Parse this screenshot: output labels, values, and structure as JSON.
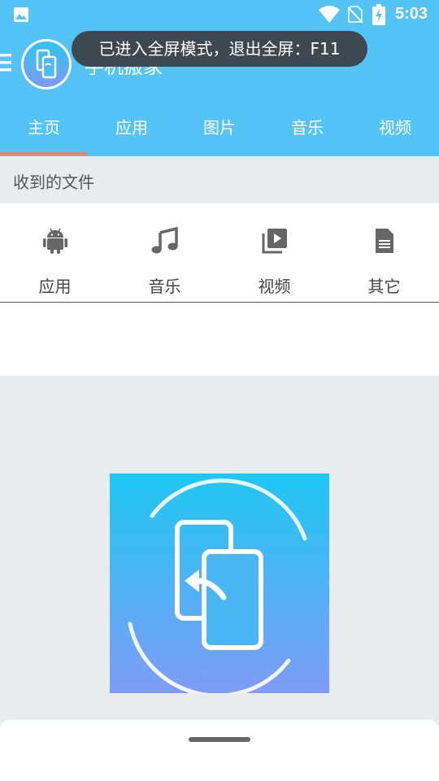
{
  "status_bar": {
    "time": "5:03",
    "icons": [
      "gallery-icon",
      "wifi-icon",
      "no-sim-icon",
      "battery-charging-icon"
    ]
  },
  "app_bar": {
    "title": "手机搬家",
    "logo_icon": "phone-transfer-icon",
    "menu_icon": "menu-icon"
  },
  "toast": {
    "text": "已进入全屏模式，退出全屏：F11"
  },
  "tabs": [
    {
      "label": "主页",
      "selected": true
    },
    {
      "label": "应用",
      "selected": false
    },
    {
      "label": "图片",
      "selected": false
    },
    {
      "label": "音乐",
      "selected": false
    },
    {
      "label": "视频",
      "selected": false
    }
  ],
  "received": {
    "section_title": "收到的文件",
    "categories": [
      {
        "label": "应用",
        "icon": "android-icon"
      },
      {
        "label": "音乐",
        "icon": "music-note-icon"
      },
      {
        "label": "视频",
        "icon": "video-library-icon"
      },
      {
        "label": "其它",
        "icon": "document-icon"
      }
    ]
  },
  "colors": {
    "primary": "#54c4f8",
    "tab_indicator": "#ff7a59",
    "background": "#e9ecef",
    "toast": "#3d4851"
  }
}
